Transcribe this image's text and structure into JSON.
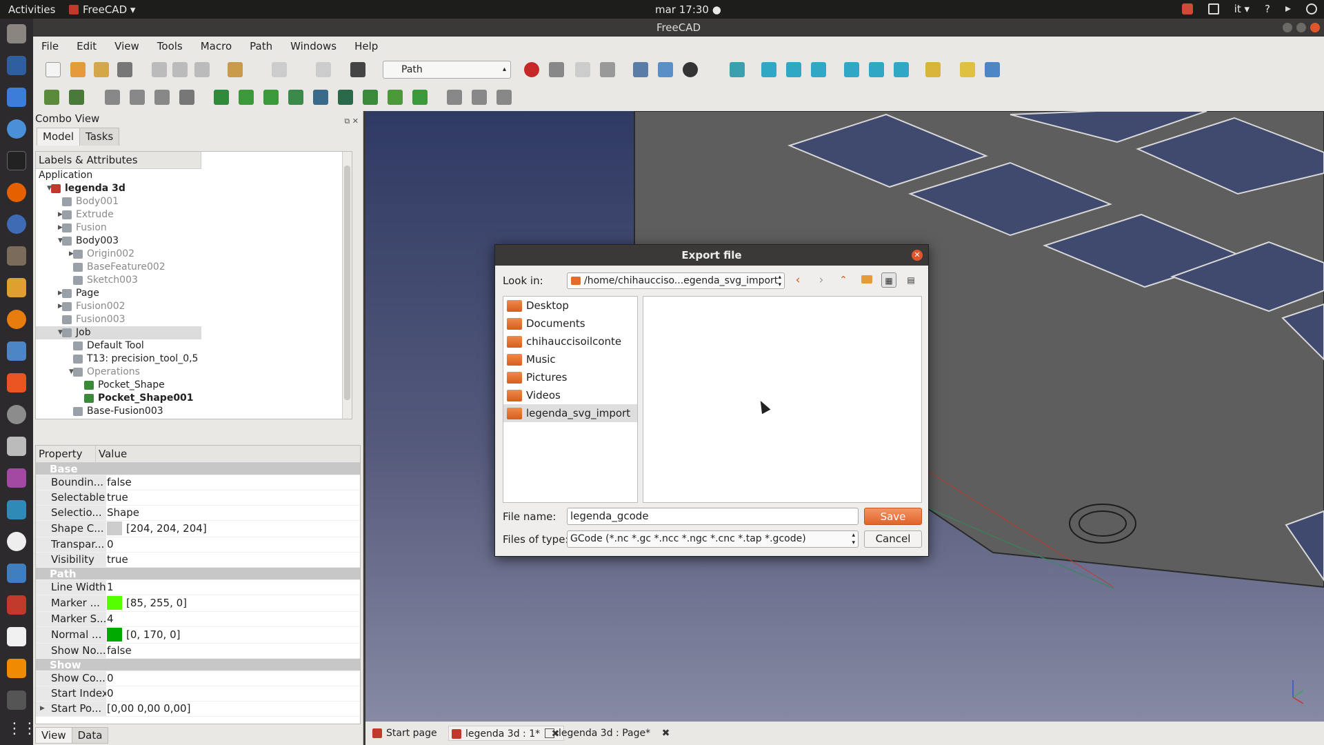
{
  "topbar": {
    "activities": "Activities",
    "app": "FreeCAD ▾",
    "clock": "mar 17:30 ●",
    "lang": "it ▾",
    "help": "?"
  },
  "window": {
    "title": "FreeCAD"
  },
  "menu": [
    "File",
    "Edit",
    "View",
    "Tools",
    "Macro",
    "Path",
    "Windows",
    "Help"
  ],
  "toolbar": {
    "workbench": "Path"
  },
  "combo": {
    "title": "Combo View",
    "tabs": [
      "Model",
      "Tasks"
    ],
    "tree_header": "Labels & Attributes",
    "tree": [
      {
        "label": "Application",
        "depth": 0,
        "style": "root"
      },
      {
        "label": "legenda 3d",
        "depth": 1,
        "style": "bold",
        "exp": "open"
      },
      {
        "label": "Body001",
        "depth": 2,
        "style": "dim"
      },
      {
        "label": "Extrude",
        "depth": 2,
        "style": "dim",
        "exp": "closed"
      },
      {
        "label": "Fusion",
        "depth": 2,
        "style": "dim",
        "exp": "closed"
      },
      {
        "label": "Body003",
        "depth": 2,
        "style": "normal",
        "exp": "open"
      },
      {
        "label": "Origin002",
        "depth": 3,
        "style": "dim",
        "exp": "closed"
      },
      {
        "label": "BaseFeature002",
        "depth": 3,
        "style": "dim"
      },
      {
        "label": "Sketch003",
        "depth": 3,
        "style": "dim"
      },
      {
        "label": "Page",
        "depth": 2,
        "style": "normal",
        "exp": "closed"
      },
      {
        "label": "Fusion002",
        "depth": 2,
        "style": "dim",
        "exp": "closed"
      },
      {
        "label": "Fusion003",
        "depth": 2,
        "style": "dim"
      },
      {
        "label": "Job",
        "depth": 2,
        "style": "sel",
        "exp": "open"
      },
      {
        "label": "Default Tool",
        "depth": 3,
        "style": "normal"
      },
      {
        "label": "T13: precision_tool_0,5",
        "depth": 3,
        "style": "normal"
      },
      {
        "label": "Operations",
        "depth": 3,
        "style": "dim",
        "exp": "open"
      },
      {
        "label": "Pocket_Shape",
        "depth": 4,
        "style": "normal"
      },
      {
        "label": "Pocket_Shape001",
        "depth": 4,
        "style": "bold"
      },
      {
        "label": "Base-Fusion003",
        "depth": 3,
        "style": "normal"
      }
    ],
    "prop_headers": {
      "property": "Property",
      "value": "Value"
    },
    "properties": [
      {
        "group": "Base"
      },
      {
        "name": "Boundin...",
        "value": "false"
      },
      {
        "name": "Selectable",
        "value": "true"
      },
      {
        "name": "Selectio...",
        "value": "Shape"
      },
      {
        "name": "Shape C...",
        "value": "[204, 204, 204]",
        "color": "#cccccc"
      },
      {
        "name": "Transpar...",
        "value": "0"
      },
      {
        "name": "Visibility",
        "value": "true"
      },
      {
        "group": "Path"
      },
      {
        "name": "Line Width",
        "value": "1"
      },
      {
        "name": "Marker ...",
        "value": "[85, 255, 0]",
        "color": "#55ff00"
      },
      {
        "name": "Marker S...",
        "value": "4"
      },
      {
        "name": "Normal ...",
        "value": "[0, 170, 0]",
        "color": "#00aa00"
      },
      {
        "name": "Show No...",
        "value": "false"
      },
      {
        "group": "Show"
      },
      {
        "name": "Show Co...",
        "value": "0"
      },
      {
        "name": "Start Index",
        "value": "0"
      },
      {
        "name": "Start Po...",
        "value": "[0,00 0,00 0,00]",
        "exp": true
      }
    ],
    "bottom_tabs": [
      "View",
      "Data"
    ]
  },
  "doc_tabs": [
    {
      "label": "Start page"
    },
    {
      "label": "legenda 3d : 1*"
    },
    {
      "label": "legenda 3d : Page*"
    }
  ],
  "dialog": {
    "title": "Export file",
    "look_in_label": "Look in:",
    "look_in_value": "/home/chihaucciso...egenda_svg_import",
    "places": [
      "Desktop",
      "Documents",
      "chihauccisoilconte",
      "Music",
      "Pictures",
      "Videos",
      "legenda_svg_import"
    ],
    "selected_place": "legenda_svg_import",
    "file_name_label": "File name:",
    "file_name_value": "legenda_gcode",
    "file_type_label": "Files of type:",
    "file_type_value": "GCode (*.nc *.gc *.ncc *.ngc *.cnc *.tap *.gcode)",
    "save_label": "Save",
    "cancel_label": "Cancel"
  }
}
